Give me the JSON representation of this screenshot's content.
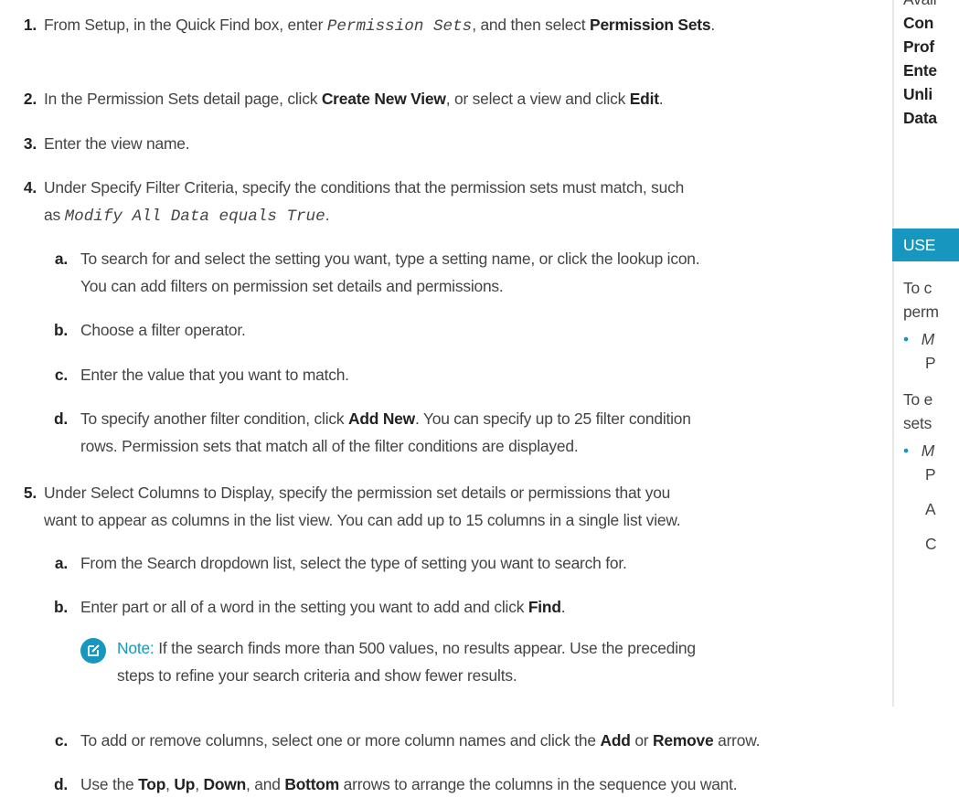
{
  "steps": {
    "s1": {
      "num": "1.",
      "pre": "From Setup, in the Quick Find box, enter ",
      "code": "Permission Sets",
      "mid": ", and then select ",
      "bold": "Permission Sets",
      "end": "."
    },
    "s2": {
      "num": "2.",
      "pre": "In the Permission Sets detail page, click ",
      "bold1": "Create New View",
      "mid": ", or select a view and click ",
      "bold2": "Edit",
      "end": "."
    },
    "s3": {
      "num": "3.",
      "text": "Enter the view name."
    },
    "s4": {
      "num": "4.",
      "line1": "Under Specify Filter Criteria, specify the conditions that the permission sets must match, such",
      "pre2": "as ",
      "code": "Modify All Data equals True",
      "end": ".",
      "a": {
        "num": "a.",
        "line1": "To search for and select the setting you want, type a setting name, or click the lookup icon.",
        "line2": "You can add filters on permission set details and permissions."
      },
      "b": {
        "num": "b.",
        "text": "Choose a filter operator."
      },
      "c": {
        "num": "c.",
        "text": "Enter the value that you want to match."
      },
      "d": {
        "num": "d.",
        "pre": "To specify another filter condition, click ",
        "bold": "Add New",
        "post": ". You can specify up to 25 filter condition",
        "line2": "rows. Permission sets that match all of the filter conditions are displayed."
      }
    },
    "s5": {
      "num": "5.",
      "line1": "Under Select Columns to Display, specify the permission set details or permissions that you",
      "line2": "want to appear as columns in the list view. You can add up to 15 columns in a single list view.",
      "a": {
        "num": "a.",
        "text": "From the Search dropdown list, select the type of setting you want to search for."
      },
      "b": {
        "num": "b.",
        "pre": "Enter part or all of a word in the setting you want to add and click ",
        "bold": "Find",
        "end": "."
      },
      "note": {
        "label": "Note:",
        "line1": "If the search finds more than 500 values, no results appear. Use the preceding",
        "line2": "steps to refine your search criteria and show fewer results."
      },
      "c": {
        "num": "c.",
        "pre": "To add or remove columns, select one or more column names and click the ",
        "bold1": "Add",
        "mid": " or ",
        "bold2": "Remove",
        "end": " arrow."
      },
      "d": {
        "num": "d.",
        "pre": "Use the ",
        "b1": "Top",
        "s1": ", ",
        "b2": "Up",
        "s2": ", ",
        "b3": "Down",
        "s3": ", and ",
        "b4": "Bottom",
        "end": " arrows to arrange the columns in the sequence you want."
      }
    }
  },
  "sidebar": {
    "avail": "Avail",
    "editions": [
      "Con",
      "Prof",
      "Ente",
      "Unli",
      "Data"
    ],
    "user_header": "USE",
    "p1_l1": "To c",
    "p1_l2": "perm",
    "bullet1": "•",
    "b1_l1": "M",
    "b1_l2": "P",
    "p2_l1": "To e",
    "p2_l2": "sets",
    "bullet2": "•",
    "b2_l1": "M",
    "b2_l2": "P",
    "b2_l3": "A",
    "b2_l4": "C"
  },
  "colors": {
    "accent": "#1797c0",
    "text": "#444444",
    "bold": "#222222"
  }
}
